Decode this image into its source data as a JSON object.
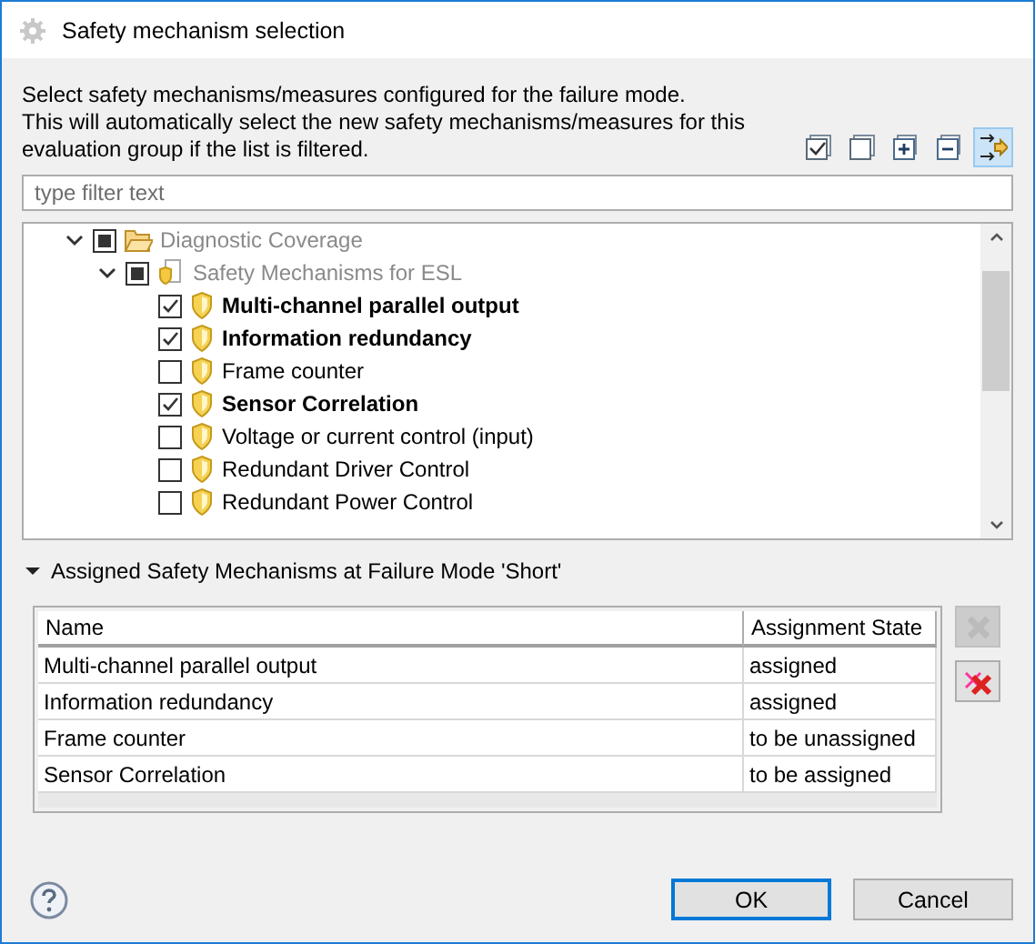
{
  "window": {
    "title": "Safety mechanism selection"
  },
  "description": [
    "Select safety mechanisms/measures configured for the failure mode.",
    "This will automatically select the new safety mechanisms/measures for this evaluation group if the list is filtered."
  ],
  "toolbar": [
    {
      "kind": "check-all"
    },
    {
      "kind": "uncheck-all"
    },
    {
      "kind": "expand-all"
    },
    {
      "kind": "collapse-all"
    }
  ],
  "filter_toggle": {
    "on": true
  },
  "filter": {
    "placeholder": "type filter text"
  },
  "tree": [
    {
      "label": "Diagnostic Coverage",
      "kind": "folder",
      "expanded": true,
      "checked": true,
      "grayed": true,
      "children": [
        {
          "label": "Safety Mechanisms for ESL",
          "kind": "group",
          "expanded": true,
          "checked": true,
          "grayed": true,
          "children": [
            {
              "label": "Multi-channel parallel output",
              "kind": "mechanism",
              "checked": true
            },
            {
              "label": "Information redundancy",
              "kind": "mechanism",
              "checked": true
            },
            {
              "label": "Frame counter",
              "kind": "mechanism",
              "checked": false
            },
            {
              "label": "Sensor Correlation",
              "kind": "mechanism",
              "checked": true
            },
            {
              "label": "Voltage or current control (input)",
              "kind": "mechanism",
              "checked": false
            },
            {
              "label": "Redundant Driver Control",
              "kind": "mechanism",
              "checked": false
            },
            {
              "label": "Redundant Power Control",
              "kind": "mechanism",
              "checked": false
            }
          ]
        }
      ]
    }
  ],
  "section": {
    "title": "Assigned Safety Mechanisms at Failure Mode 'Short'",
    "expanded": true
  },
  "table": {
    "columns": [
      "Name",
      "Assignment State"
    ],
    "rows": [
      [
        "Multi-channel parallel output",
        "assigned"
      ],
      [
        "Information redundancy",
        "assigned"
      ],
      [
        "Frame counter",
        "to be unassigned"
      ],
      [
        "Sensor Correlation",
        "to be assigned"
      ]
    ]
  },
  "side_buttons": [
    {
      "kind": "remove",
      "disabled": true
    },
    {
      "kind": "remove-all",
      "disabled": false
    }
  ],
  "buttons": [
    {
      "label": "OK",
      "default": true
    },
    {
      "label": "Cancel",
      "default": false
    }
  ]
}
